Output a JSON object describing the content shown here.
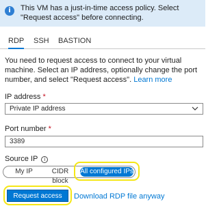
{
  "banner": {
    "icon": "info-icon",
    "text": "This VM has a just-in-time access policy. Select \"Request access\" before connecting."
  },
  "tabs": [
    {
      "label": "RDP",
      "selected": true
    },
    {
      "label": "SSH",
      "selected": false
    },
    {
      "label": "BASTION",
      "selected": false
    }
  ],
  "description": {
    "text": "You need to request access to connect to your virtual machine. Select an IP address, optionally change the port number, and select \"Request access\".",
    "link": "Learn more"
  },
  "ip_address": {
    "label": "IP address",
    "required_mark": "*",
    "value": "Private IP address"
  },
  "port_number": {
    "label": "Port number",
    "required_mark": "*",
    "value": "3389"
  },
  "source_ip": {
    "label": "Source IP",
    "options": [
      "My IP",
      "CIDR block",
      "All configured IPs"
    ],
    "selected": "All configured IPs"
  },
  "actions": {
    "request_access": "Request access",
    "download_rdp": "Download RDP file anyway"
  },
  "colors": {
    "accent": "#0078d4",
    "banner_bg": "#dcebf8",
    "highlight": "#f5e614",
    "required": "#c50f1f"
  }
}
